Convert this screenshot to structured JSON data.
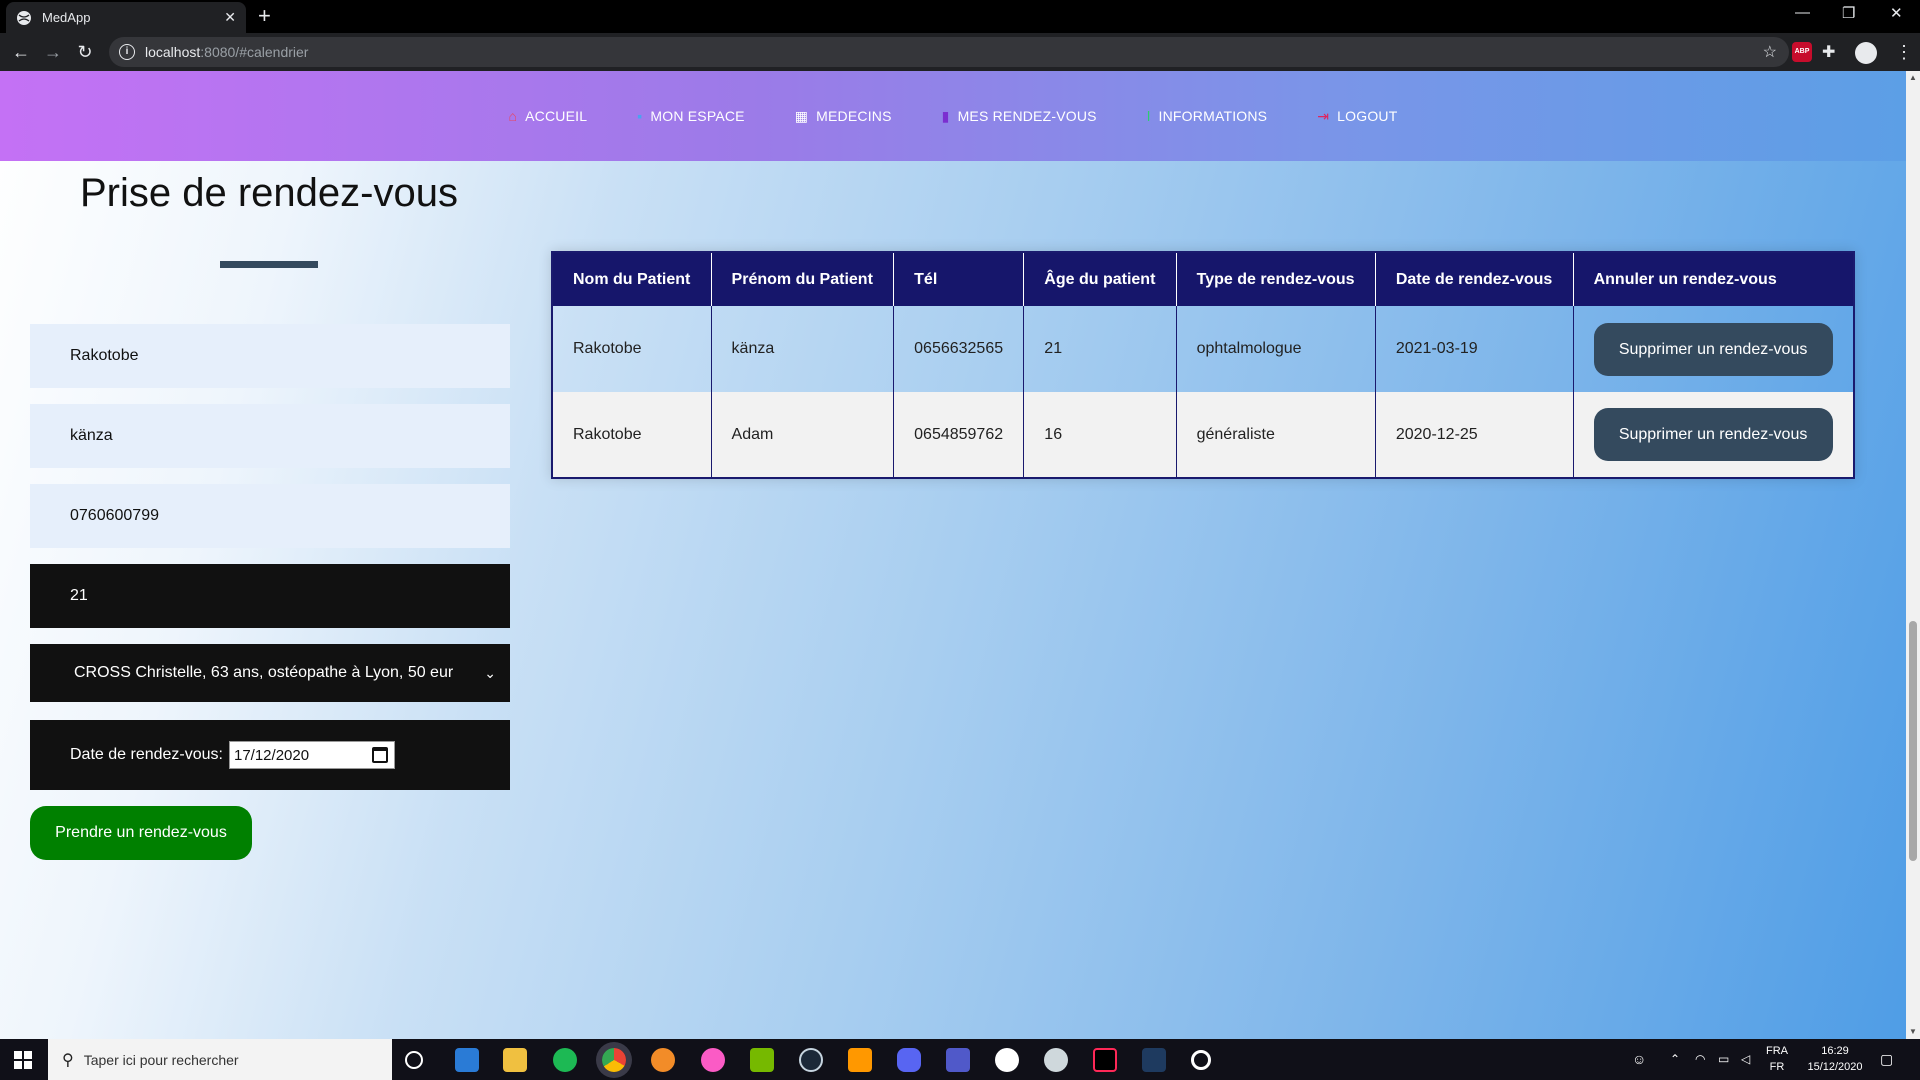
{
  "browser": {
    "tab_title": "MedApp",
    "url_host": "localhost",
    "url_rest": ":8080/#calendrier"
  },
  "nav": {
    "items": [
      {
        "label": "ACCUEIL",
        "icon": "home-icon",
        "color": "#e94560"
      },
      {
        "label": "MON ESPACE",
        "icon": "user-icon",
        "color": "#4aa3f0"
      },
      {
        "label": "MEDECINS",
        "icon": "hospital-icon",
        "color": "#ffffff"
      },
      {
        "label": "MES RENDEZ-VOUS",
        "icon": "calendar-icon",
        "color": "#7b2fd0"
      },
      {
        "label": "INFORMATIONS",
        "icon": "info-icon",
        "color": "#2ecc71"
      },
      {
        "label": "LOGOUT",
        "icon": "logout-icon",
        "color": "#e0245e"
      }
    ]
  },
  "form": {
    "title": "Prise de rendez-vous",
    "nom": "Rakotobe",
    "prenom": "känza",
    "tel": "0760600799",
    "age": "21",
    "medecin": "CROSS Christelle, 63 ans, ostéopathe à Lyon, 50 eur",
    "date_label": "Date de rendez-vous:",
    "date_value": "17/12/2020",
    "submit_label": "Prendre un rendez-vous"
  },
  "table": {
    "headers": [
      "Nom du Patient",
      "Prénom du Patient",
      "Tél",
      "Âge du patient",
      "Type de rendez-vous",
      "Date de rendez-vous",
      "Annuler un rendez-vous"
    ],
    "rows": [
      {
        "nom": "Rakotobe",
        "prenom": "känza",
        "tel": "0656632565",
        "age": "21",
        "type": "ophtalmologue",
        "date": "2021-03-19",
        "action": "Supprimer un rendez-vous"
      },
      {
        "nom": "Rakotobe",
        "prenom": "Adam",
        "tel": "0654859762",
        "age": "16",
        "type": "généraliste",
        "date": "2020-12-25",
        "action": "Supprimer un rendez-vous"
      }
    ]
  },
  "taskbar": {
    "search_placeholder": "Taper ici pour rechercher",
    "lang_top": "FRA",
    "lang_bottom": "FR",
    "time": "16:29",
    "date": "15/12/2020"
  },
  "colors": {
    "nav_gradient_start": "#c471f5",
    "nav_gradient_end": "#5c9fe6",
    "table_header": "#16166b",
    "delete_button": "#344a5e",
    "submit_button": "#008000"
  }
}
